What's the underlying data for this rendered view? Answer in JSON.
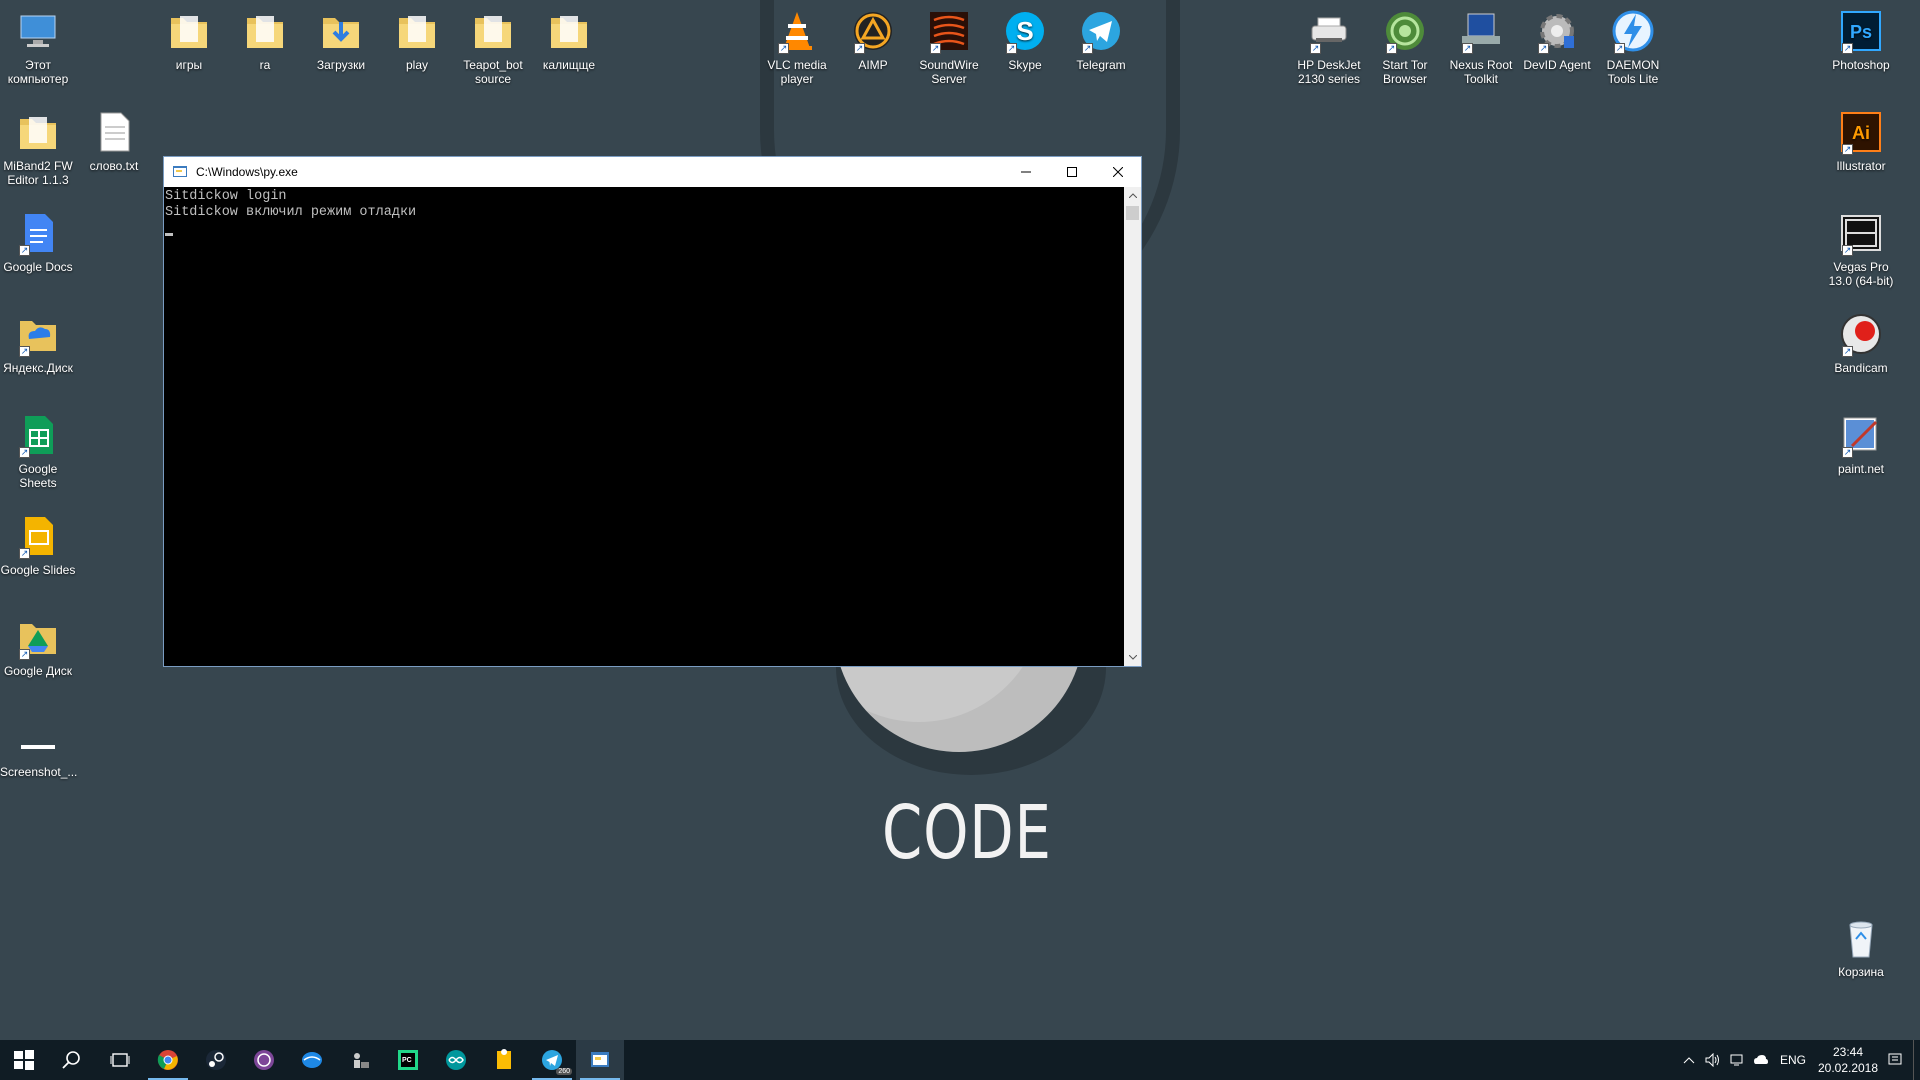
{
  "desktop": {
    "icons": [
      {
        "label": "Этот компьютер",
        "icon": "this-pc-icon"
      },
      {
        "label": "игры",
        "icon": "folder-icon"
      },
      {
        "label": "ra",
        "icon": "folder-icon"
      },
      {
        "label": "Загрузки",
        "icon": "downloads-folder-icon"
      },
      {
        "label": "play",
        "icon": "folder-icon"
      },
      {
        "label": "Teapot_bot source",
        "icon": "folder-icon"
      },
      {
        "label": "калищще",
        "icon": "folder-icon"
      },
      {
        "label": "VLC media player",
        "icon": "vlc-icon"
      },
      {
        "label": "AIMP",
        "icon": "aimp-icon"
      },
      {
        "label": "SoundWire Server",
        "icon": "soundwire-icon"
      },
      {
        "label": "Skype",
        "icon": "skype-icon"
      },
      {
        "label": "Telegram",
        "icon": "telegram-icon"
      },
      {
        "label": "HP DeskJet 2130 series",
        "icon": "printer-icon"
      },
      {
        "label": "Start Tor Browser",
        "icon": "tor-icon"
      },
      {
        "label": "Nexus Root Toolkit",
        "icon": "nexus-icon"
      },
      {
        "label": "DevID Agent",
        "icon": "devid-icon"
      },
      {
        "label": "DAEMON Tools Lite",
        "icon": "daemon-icon"
      },
      {
        "label": "Photoshop",
        "icon": "photoshop-icon"
      },
      {
        "label": "MiBand2 FW Editor 1.1.3",
        "icon": "folder-icon"
      },
      {
        "label": "слово.txt",
        "icon": "text-file-icon"
      },
      {
        "label": "Illustrator",
        "icon": "illustrator-icon"
      },
      {
        "label": "Google Docs",
        "icon": "google-docs-icon"
      },
      {
        "label": "Vegas Pro 13.0 (64-bit)",
        "icon": "vegas-icon"
      },
      {
        "label": "Яндекс.Диск",
        "icon": "yandex-disk-icon"
      },
      {
        "label": "Bandicam",
        "icon": "bandicam-icon"
      },
      {
        "label": "Google Sheets",
        "icon": "google-sheets-icon"
      },
      {
        "label": "paint.net",
        "icon": "paintnet-icon"
      },
      {
        "label": "Google Slides",
        "icon": "google-slides-icon"
      },
      {
        "label": "Google Диск",
        "icon": "google-drive-icon"
      },
      {
        "label": "Screenshot_...",
        "icon": "image-file-icon"
      },
      {
        "label": "Корзина",
        "icon": "recycle-bin-icon"
      }
    ]
  },
  "wallpaper": {
    "text": "CODE"
  },
  "window": {
    "title": "C:\\Windows\\py.exe",
    "lines": [
      "Sitdickow login",
      "Sitdickow включил режим отладки"
    ]
  },
  "taskbar": {
    "items": [
      "start-icon",
      "search-icon",
      "task-view-icon",
      "chrome-icon",
      "steam-icon",
      "tor-browser-icon",
      "app-icon",
      "toolkit-icon",
      "pycharm-icon",
      "arduino-icon",
      "notes-icon",
      "telegram-icon",
      "python-console-icon"
    ],
    "lang": "ENG",
    "time": "23:44",
    "date": "20.02.2018",
    "telegram_badge": "260"
  },
  "colors": {
    "desktop_bg": "#37464f",
    "taskbar_bg": "#101c24",
    "accent": "#76b9ed"
  }
}
